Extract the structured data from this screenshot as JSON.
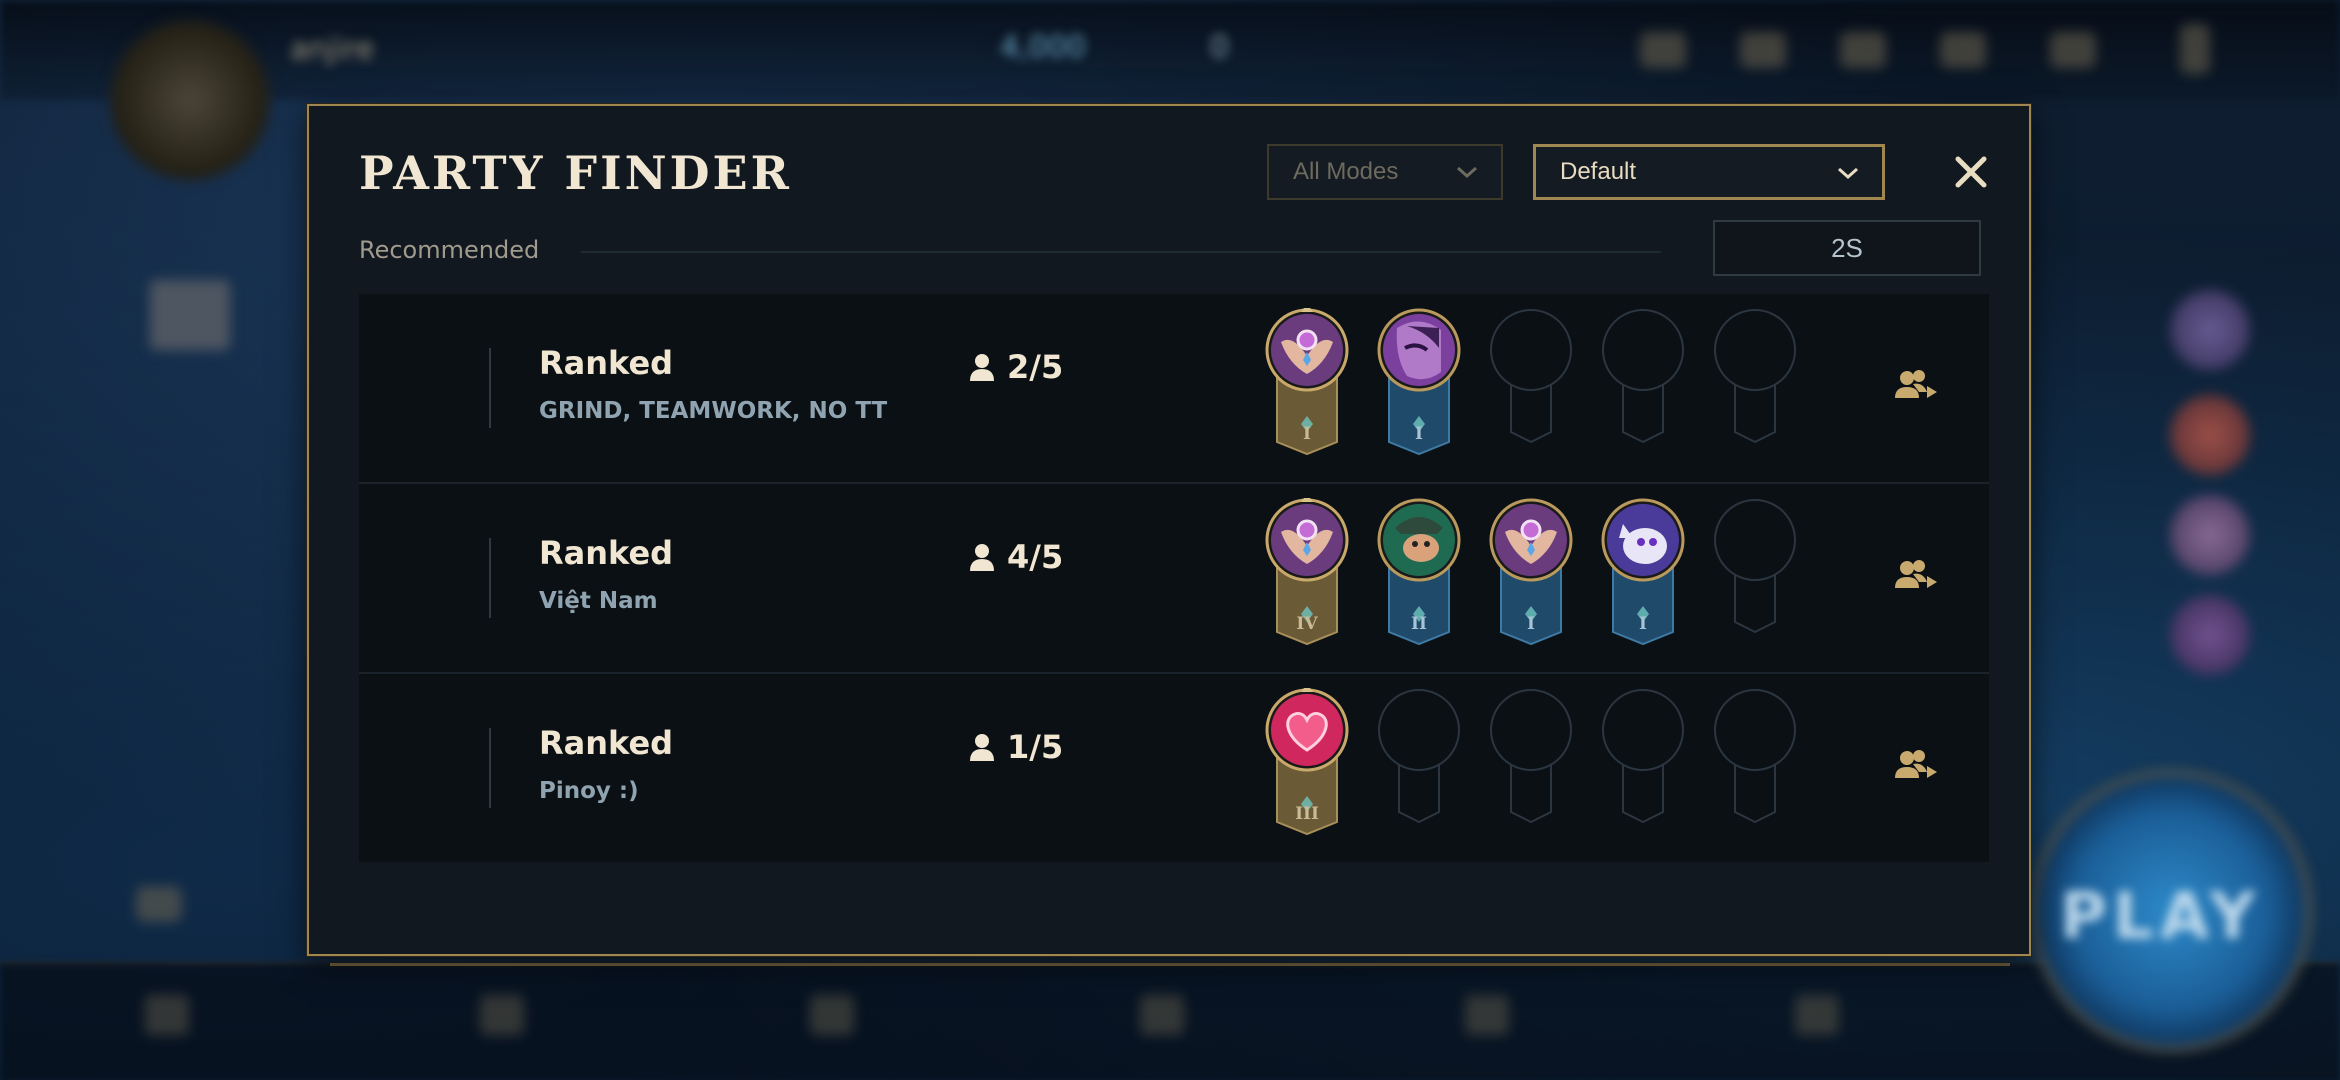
{
  "background": {
    "username": "anjire",
    "currency_rp": "4,000",
    "currency_be": "0",
    "play_button": "PLAY"
  },
  "modal": {
    "title": "PARTY FINDER",
    "mode_filter": {
      "value": "All Modes",
      "icon": "chevron-down-icon"
    },
    "sort_filter": {
      "value": "Default",
      "icon": "chevron-down-icon"
    },
    "close_icon": "close-icon",
    "section_label": "Recommended",
    "search_value": "2S"
  },
  "parties": [
    {
      "mode": "Ranked",
      "description": "GRIND, TEAMWORK, NO TT",
      "count": "2/5",
      "members": [
        {
          "icon": "winged-crest-icon",
          "rank": "I",
          "banner": "gold"
        },
        {
          "icon": "champion-portrait-purple",
          "rank": "I",
          "banner": "blue"
        },
        {
          "empty": true
        },
        {
          "empty": true
        },
        {
          "empty": true
        }
      ]
    },
    {
      "mode": "Ranked",
      "description": "Việt Nam",
      "count": "4/5",
      "members": [
        {
          "icon": "winged-crest-icon",
          "rank": "IV",
          "banner": "gold"
        },
        {
          "icon": "champion-portrait-green",
          "rank": "II",
          "banner": "blue"
        },
        {
          "icon": "winged-crest-icon",
          "rank": "I",
          "banner": "blue"
        },
        {
          "icon": "white-creature-icon",
          "rank": "I",
          "banner": "blue"
        },
        {
          "empty": true
        }
      ]
    },
    {
      "mode": "Ranked",
      "description": "Pinoy :)",
      "count": "1/5",
      "members": [
        {
          "icon": "heart-icon",
          "rank": "III",
          "banner": "gold"
        },
        {
          "empty": true
        },
        {
          "empty": true
        },
        {
          "empty": true
        },
        {
          "empty": true
        }
      ]
    }
  ],
  "colors": {
    "gold_border": "#a0864f",
    "title_text": "#f0e6d2",
    "desc_text": "#8fa3b0",
    "modal_bg": "#111820",
    "row_bg": "#0b1014"
  }
}
